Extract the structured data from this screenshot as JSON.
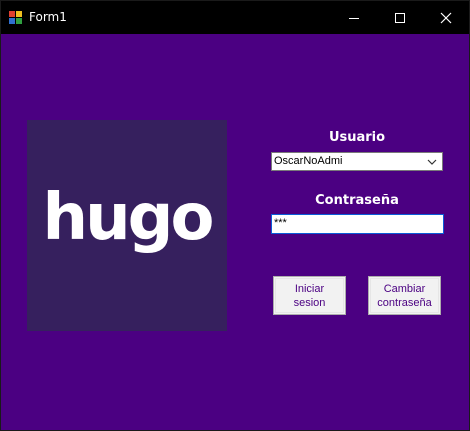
{
  "window": {
    "title": "Form1",
    "icon": "app-form-icon",
    "controls": [
      "minimize-icon",
      "maximize-icon",
      "close-icon"
    ]
  },
  "colors": {
    "background": "#4b0082",
    "logo_panel": "#36205e",
    "titlebar": "#000000",
    "button_text": "#4b0082"
  },
  "logo": {
    "text": "hugo"
  },
  "form": {
    "user_label": "Usuario",
    "user_value": "OscarNoAdmi",
    "password_label": "Contraseña",
    "password_value": "***"
  },
  "buttons": {
    "login_line1": "Iniciar",
    "login_line2": "sesion",
    "change_line1": "Cambiar",
    "change_line2": "contraseña"
  }
}
